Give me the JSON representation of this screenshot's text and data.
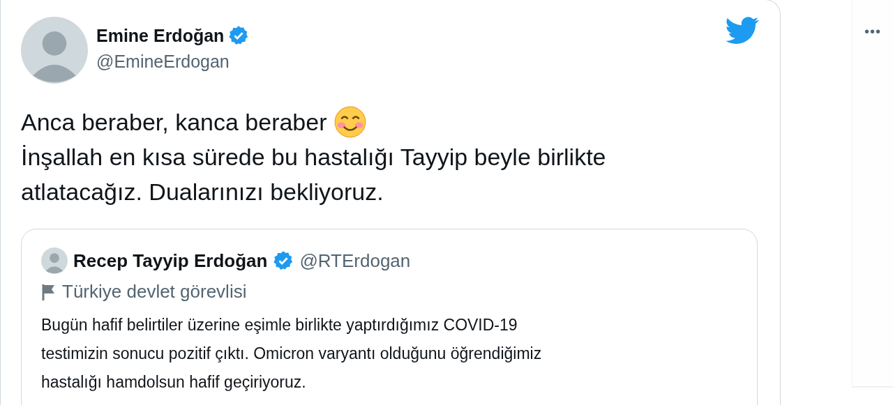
{
  "tweet": {
    "author": {
      "name": "Emine Erdoğan",
      "verified": true,
      "handle": "@EmineErdogan"
    },
    "text_lines": [
      "Anca beraber, kanca beraber",
      "İnşallah en kısa sürede bu hastalığı Tayyip beyle birlikte\natlatacağız. Dualarınızı bekliyoruz."
    ],
    "quoted": {
      "author": {
        "name": "Recep Tayyip Erdoğan",
        "verified": true,
        "handle": "@RTErdogan"
      },
      "label": "Türkiye devlet görevlisi",
      "text": "Bugün hafif belirtiler üzerine eşimle birlikte yaptırdığımız COVID-19\ntestimizin sonucu pozitif çıktı. Omicron varyantı olduğunu öğrendiğimiz\nhastalığı hamdolsun hafif geçiriyoruz."
    }
  },
  "side_menu": {
    "label": "•••"
  }
}
